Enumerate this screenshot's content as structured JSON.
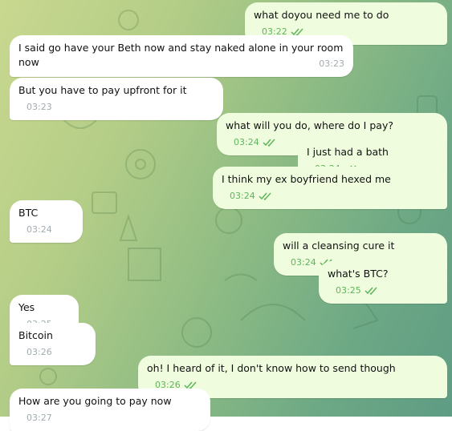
{
  "theme": {
    "incoming_bg": "#ffffff",
    "outgoing_bg": "#effdde",
    "accent": "#5eb55b"
  },
  "messages": [
    {
      "dir": "out",
      "text": "what doyou need me to do",
      "time": "03:22",
      "read": true
    },
    {
      "dir": "in",
      "text": "I said go have your Beth now and stay naked alone in your room now",
      "time": "03:23"
    },
    {
      "dir": "in",
      "text": "But you have to pay upfront for it",
      "time": "03:23"
    },
    {
      "dir": "out",
      "text": "what will you do, where do I pay?",
      "time": "03:24",
      "read": true
    },
    {
      "dir": "out",
      "text": "I just had a bath",
      "time": "03:24",
      "read": true
    },
    {
      "dir": "out",
      "text": "I think my ex boyfriend hexed me",
      "time": "03:24",
      "read": true
    },
    {
      "dir": "in",
      "text": "BTC",
      "time": "03:24"
    },
    {
      "dir": "out",
      "text": "will a cleansing cure it",
      "time": "03:24",
      "read": true
    },
    {
      "dir": "out",
      "text": "what's BTC?",
      "time": "03:25",
      "read": true
    },
    {
      "dir": "in",
      "text": "Yes",
      "time": "03:25"
    },
    {
      "dir": "in",
      "text": "Bitcoin",
      "time": "03:26"
    },
    {
      "dir": "out",
      "text": "oh! I heard of it, I don't know how to send though",
      "time": "03:26",
      "read": true
    },
    {
      "dir": "in",
      "text": "How are you going to pay now",
      "time": "03:27"
    }
  ]
}
